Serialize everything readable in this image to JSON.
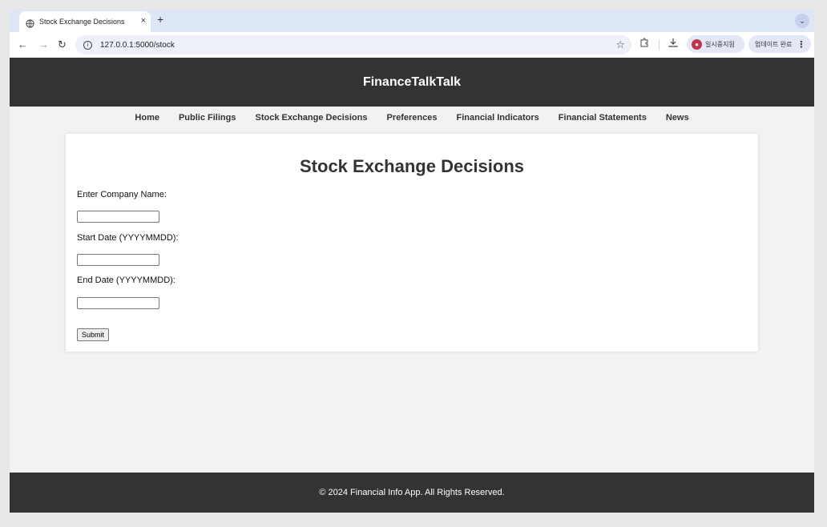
{
  "browser": {
    "tab_title": "Stock Exchange Decisions",
    "tab_close": "×",
    "new_tab": "+",
    "dropdown": "⌄",
    "url": "127.0.0.1:5000/stock",
    "profile_label": "일시중지됨",
    "update_label": "업데이트 완료",
    "icons": [
      "globe-icon",
      "back-arrow-icon",
      "forward-arrow-icon",
      "reload-icon",
      "info-icon",
      "star-icon",
      "extensions-icon",
      "download-icon",
      "avatar-icon",
      "menu-kebab-icon"
    ]
  },
  "site": {
    "title": "FinanceTalkTalk",
    "nav": [
      {
        "label": "Home"
      },
      {
        "label": "Public Filings"
      },
      {
        "label": "Stock Exchange Decisions"
      },
      {
        "label": "Preferences"
      },
      {
        "label": "Financial Indicators"
      },
      {
        "label": "Financial Statements"
      },
      {
        "label": "News"
      }
    ],
    "footer": "© 2024 Financial Info App. All Rights Reserved."
  },
  "form": {
    "heading": "Stock Exchange Decisions",
    "company_label": "Enter Company Name:",
    "company_value": "",
    "start_label": "Start Date (YYYYMMDD):",
    "start_value": "",
    "end_label": "End Date (YYYYMMDD):",
    "end_value": "",
    "submit_label": "Submit"
  }
}
